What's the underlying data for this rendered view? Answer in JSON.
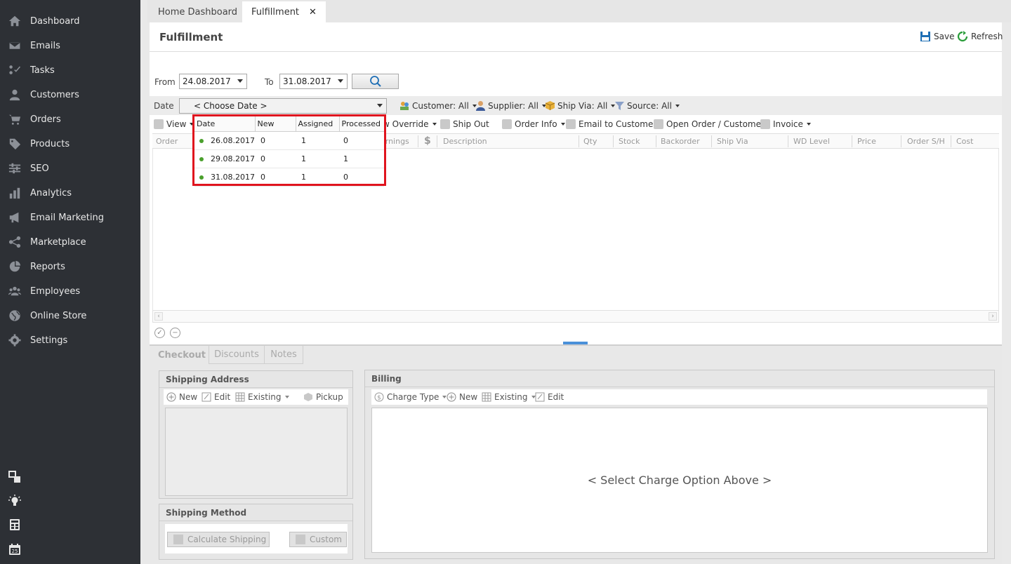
{
  "sidebar": {
    "items": [
      {
        "label": "Dashboard",
        "icon": "home-icon"
      },
      {
        "label": "Emails",
        "icon": "envelope-icon"
      },
      {
        "label": "Tasks",
        "icon": "tasks-icon"
      },
      {
        "label": "Customers",
        "icon": "person-icon"
      },
      {
        "label": "Orders",
        "icon": "cart-icon"
      },
      {
        "label": "Products",
        "icon": "tag-icon"
      },
      {
        "label": "SEO",
        "icon": "sliders-icon"
      },
      {
        "label": "Analytics",
        "icon": "bar-chart-icon"
      },
      {
        "label": "Email Marketing",
        "icon": "megaphone-icon"
      },
      {
        "label": "Marketplace",
        "icon": "share-icon"
      },
      {
        "label": "Reports",
        "icon": "pie-chart-icon"
      },
      {
        "label": "Employees",
        "icon": "group-icon"
      },
      {
        "label": "Online Store",
        "icon": "globe-icon"
      },
      {
        "label": "Settings",
        "icon": "gear-icon"
      }
    ],
    "tools": [
      "windows-icon",
      "lightbulb-icon",
      "calculator-icon",
      "calendar-icon"
    ]
  },
  "tabs": {
    "home": "Home Dashboard",
    "fulfillment": "Fulfillment"
  },
  "header": {
    "title": "Fulfillment",
    "save": "Save",
    "refresh": "Refresh"
  },
  "filters": {
    "from_label": "From",
    "from_value": "24.08.2017",
    "to_label": "To",
    "to_value": "31.08.2017",
    "date_label": "Date",
    "date_value": "< Choose Date >",
    "customer": "Customer: All",
    "supplier": "Supplier: All",
    "ship_via": "Ship Via: All",
    "source": "Source: All"
  },
  "actions": {
    "view": "View",
    "override": "w Override",
    "ship_out": "Ship Out",
    "order_info": "Order Info",
    "email_customer": "Email to Customer",
    "open_order": "Open Order / Customer",
    "invoice": "Invoice"
  },
  "grid": {
    "columns": [
      "Order",
      "arnings",
      "Description",
      "Qty",
      "Stock",
      "Backorder",
      "Ship Via",
      "WD Level",
      "Price",
      "Order S/H",
      "Cost"
    ]
  },
  "date_popup": {
    "headers": [
      "Date",
      "New",
      "Assigned",
      "Processed"
    ],
    "rows": [
      {
        "date": "26.08.2017",
        "new": "0",
        "assigned": "1",
        "processed": "0"
      },
      {
        "date": "29.08.2017",
        "new": "0",
        "assigned": "1",
        "processed": "1"
      },
      {
        "date": "31.08.2017",
        "new": "0",
        "assigned": "1",
        "processed": "0"
      }
    ]
  },
  "bottom_tabs": {
    "checkout": "Checkout",
    "discounts": "Discounts",
    "notes": "Notes"
  },
  "shipping_address": {
    "title": "Shipping Address",
    "new": "New",
    "edit": "Edit",
    "existing": "Existing",
    "pickup": "Pickup"
  },
  "shipping_method": {
    "title": "Shipping Method",
    "calculate": "Calculate Shipping",
    "custom": "Custom"
  },
  "billing": {
    "title": "Billing",
    "charge_type": "Charge Type",
    "new": "New",
    "existing": "Existing",
    "edit": "Edit",
    "placeholder": "< Select Charge Option Above >"
  },
  "colors": {
    "sidebar_bg": "#2d3035",
    "highlight": "#e0141e",
    "accent": "#4a90d9",
    "status_green": "#4aa02c"
  }
}
